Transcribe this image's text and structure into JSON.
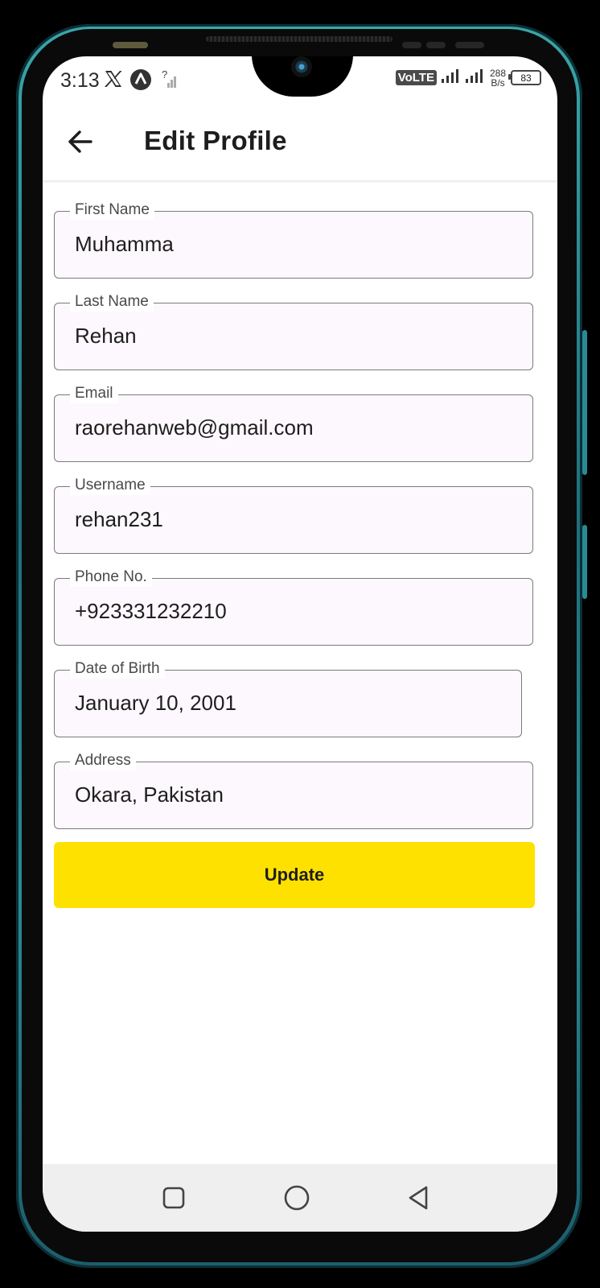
{
  "status_bar": {
    "time": "3:13",
    "volte": "VoLTE",
    "net_speed_value": "288",
    "net_speed_unit": "B/s",
    "battery": "83",
    "icons": [
      "x-icon",
      "a-notification-icon",
      "no-signal-icon",
      "signal-icon",
      "battery-icon"
    ]
  },
  "app_bar": {
    "title": "Edit Profile",
    "back_icon": "arrow-left-icon"
  },
  "form": {
    "first_name": {
      "label": "First Name",
      "value": "Muhamma"
    },
    "last_name": {
      "label": "Last Name",
      "value": "Rehan"
    },
    "email": {
      "label": "Email",
      "value": "raorehanweb@gmail.com"
    },
    "username": {
      "label": "Username",
      "value": "rehan231"
    },
    "phone": {
      "label": "Phone No.",
      "value": "+923331232210"
    },
    "dob": {
      "label": "Date of Birth",
      "value": "January 10, 2001"
    },
    "address": {
      "label": "Address",
      "value": "Okara, Pakistan"
    }
  },
  "actions": {
    "update_label": "Update"
  },
  "nav": {
    "icons": [
      "square-recents-icon",
      "circle-home-icon",
      "triangle-back-icon"
    ]
  },
  "colors": {
    "accent": "#ffe100",
    "field_bg": "#fdf8fd",
    "frame": "#2a8a94"
  }
}
